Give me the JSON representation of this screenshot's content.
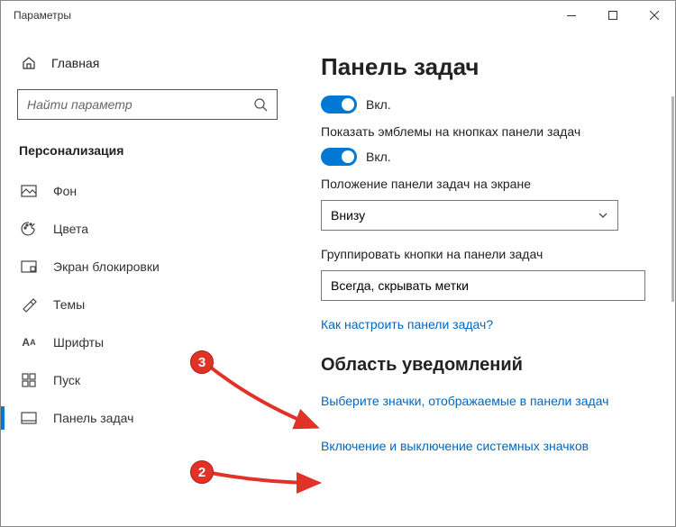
{
  "window": {
    "title": "Параметры"
  },
  "sidebar": {
    "home": "Главная",
    "search_placeholder": "Найти параметр",
    "group": "Персонализация",
    "items": [
      {
        "label": "Фон"
      },
      {
        "label": "Цвета"
      },
      {
        "label": "Экран блокировки"
      },
      {
        "label": "Темы"
      },
      {
        "label": "Шрифты"
      },
      {
        "label": "Пуск"
      },
      {
        "label": "Панель задач"
      }
    ]
  },
  "main": {
    "heading": "Панель задач",
    "toggle1_label": "Вкл.",
    "emblems_label": "Показать эмблемы на кнопках панели задач",
    "toggle2_label": "Вкл.",
    "position_label": "Положение панели задач на экране",
    "position_value": "Внизу",
    "group_label": "Группировать кнопки на панели задач",
    "group_value": "Всегда, скрывать метки",
    "help_link": "Как настроить панели задач?",
    "section2": "Область уведомлений",
    "link_icons": "Выберите значки, отображаемые в панели задач",
    "link_system": "Включение и выключение системных значков"
  },
  "annotations": {
    "badge2": "2",
    "badge3": "3"
  }
}
